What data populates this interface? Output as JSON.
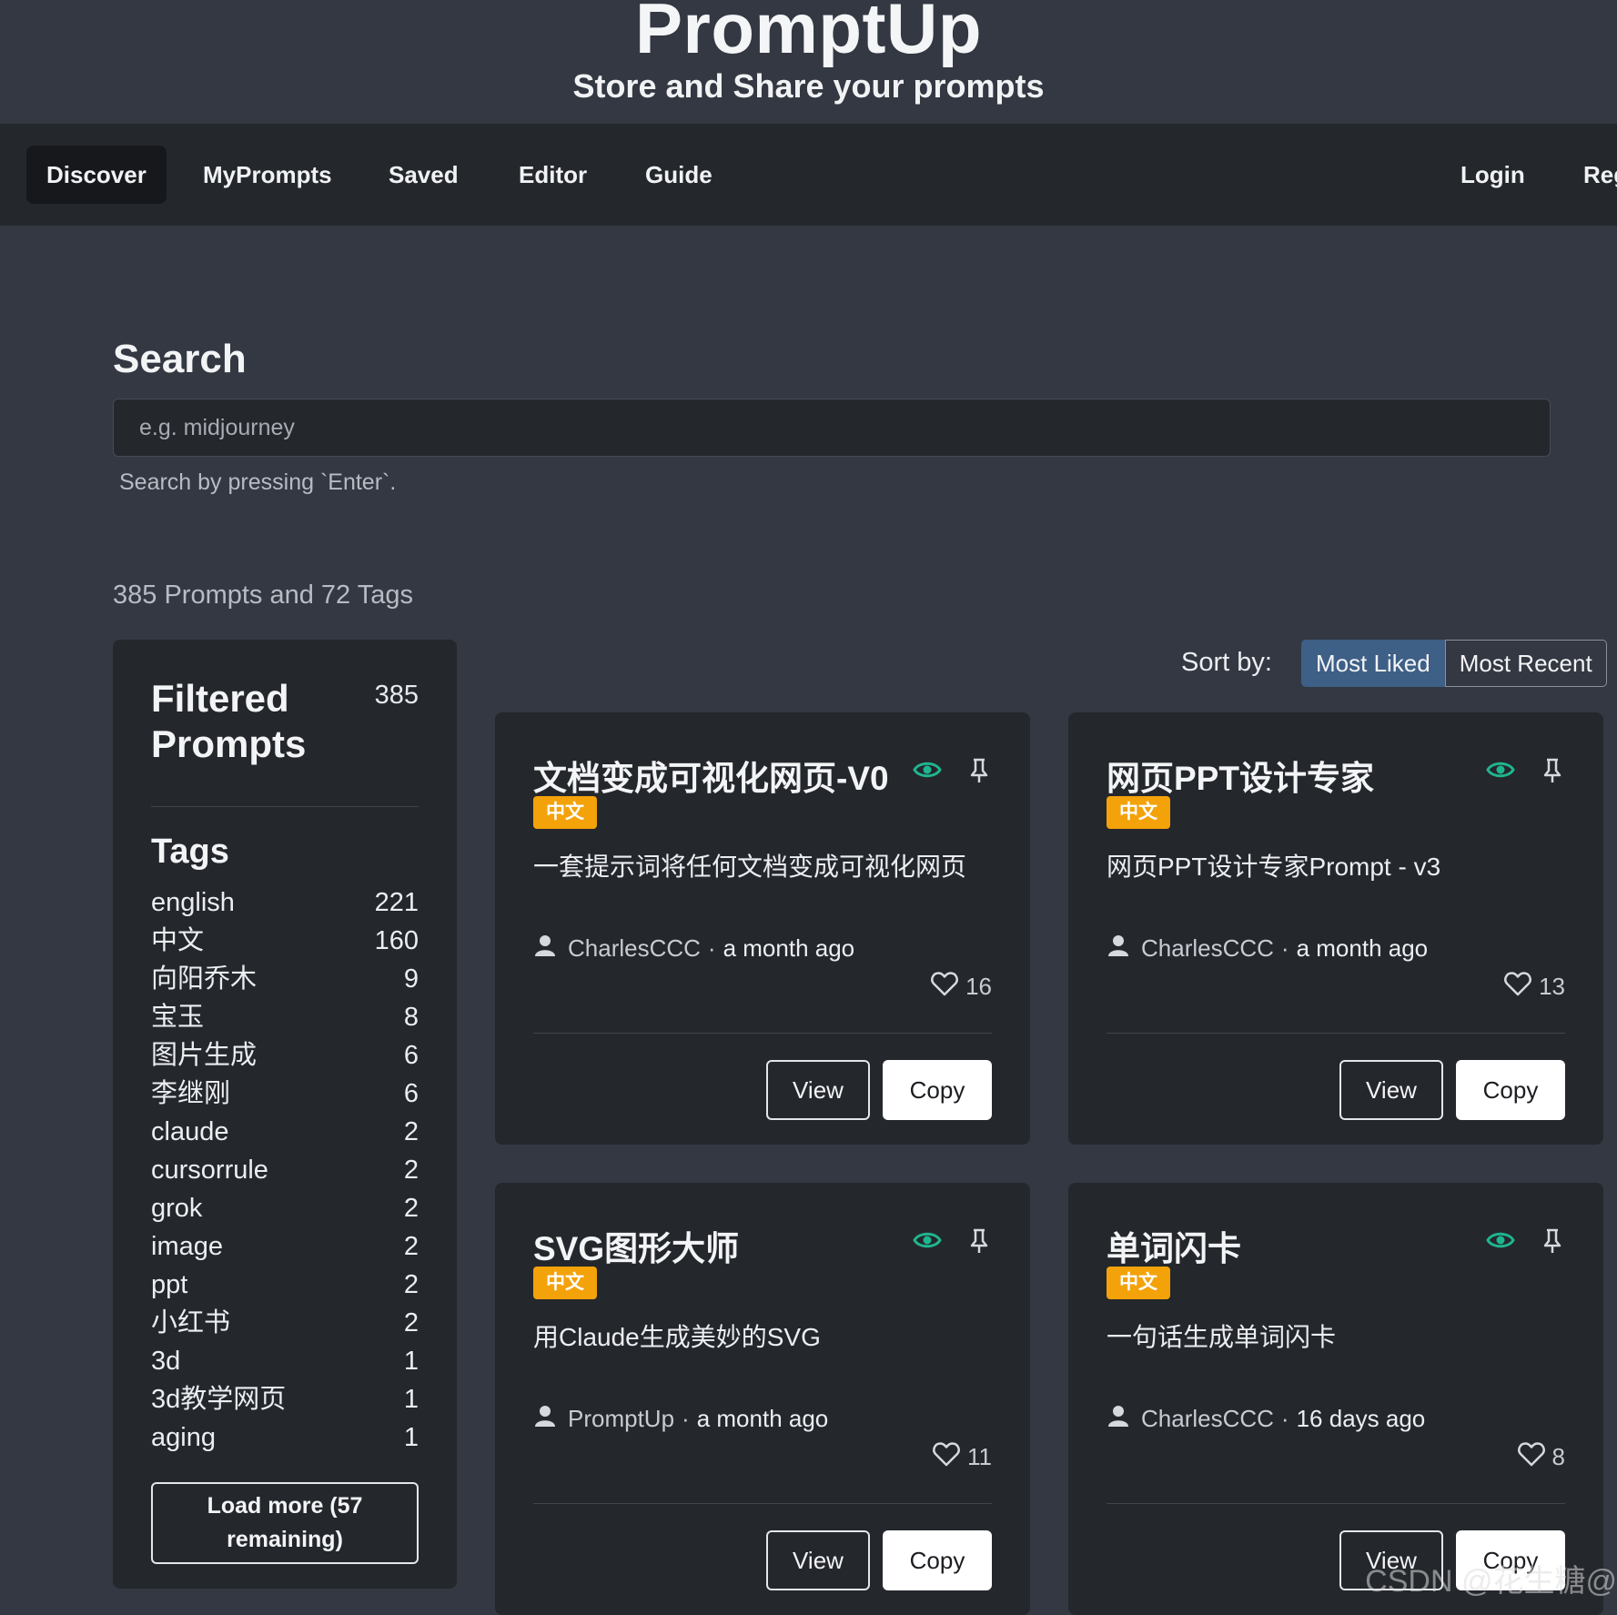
{
  "site": {
    "brand": "PromptUp",
    "tagline": "Store and Share your prompts"
  },
  "nav": {
    "discover": "Discover",
    "myprompts": "MyPrompts",
    "saved": "Saved",
    "editor": "Editor",
    "guide": "Guide",
    "login": "Login",
    "register": "Reg"
  },
  "search": {
    "title": "Search",
    "placeholder": "e.g. midjourney",
    "help": "Search by pressing `Enter`."
  },
  "summary": "385 Prompts and 72 Tags",
  "sidebar": {
    "filtered_title": "Filtered Prompts",
    "filtered_count": "385",
    "tags_title": "Tags",
    "tags": [
      {
        "name": "english",
        "count": "221"
      },
      {
        "name": "中文",
        "count": "160"
      },
      {
        "name": "向阳乔木",
        "count": "9"
      },
      {
        "name": "宝玉",
        "count": "8"
      },
      {
        "name": "图片生成",
        "count": "6"
      },
      {
        "name": "李继刚",
        "count": "6"
      },
      {
        "name": "claude",
        "count": "2"
      },
      {
        "name": "cursorrule",
        "count": "2"
      },
      {
        "name": "grok",
        "count": "2"
      },
      {
        "name": "image",
        "count": "2"
      },
      {
        "name": "ppt",
        "count": "2"
      },
      {
        "name": "小红书",
        "count": "2"
      },
      {
        "name": "3d",
        "count": "1"
      },
      {
        "name": "3d教学网页",
        "count": "1"
      },
      {
        "name": "aging",
        "count": "1"
      }
    ],
    "load_more": "Load more (57 remaining)"
  },
  "sort": {
    "label": "Sort by:",
    "most_liked": "Most Liked",
    "most_recent": "Most Recent"
  },
  "cards": [
    {
      "title": "文档变成可视化网页-V0",
      "badge": "中文",
      "description": "一套提示词将任何文档变成可视化网页",
      "author": "CharlesCCC",
      "sep": "·",
      "time": "a month ago",
      "likes": "16",
      "view": "View",
      "copy": "Copy"
    },
    {
      "title": "网页PPT设计专家",
      "badge": "中文",
      "description": "网页PPT设计专家Prompt - v3",
      "author": "CharlesCCC",
      "sep": "·",
      "time": "a month ago",
      "likes": "13",
      "view": "View",
      "copy": "Copy"
    },
    {
      "title": "SVG图形大师",
      "badge": "中文",
      "description": "用Claude生成美妙的SVG",
      "author": "PromptUp",
      "sep": "·",
      "time": "a month ago",
      "likes": "11",
      "view": "View",
      "copy": "Copy"
    },
    {
      "title": "单词闪卡",
      "badge": "中文",
      "description": "一句话生成单词闪卡",
      "author": "CharlesCCC",
      "sep": "·",
      "time": "16 days ago",
      "likes": "8",
      "view": "View",
      "copy": "Copy"
    }
  ],
  "watermark": "CSDN @花生糖@",
  "icons": {
    "eye": "eye-icon",
    "pin": "pin-icon",
    "user": "user-icon",
    "heart": "heart-icon"
  },
  "colors": {
    "background": "#333842",
    "panel": "#24272c",
    "badge": "#f3a20a",
    "eye": "#1fb58f",
    "sort_active": "#3e5f86"
  }
}
